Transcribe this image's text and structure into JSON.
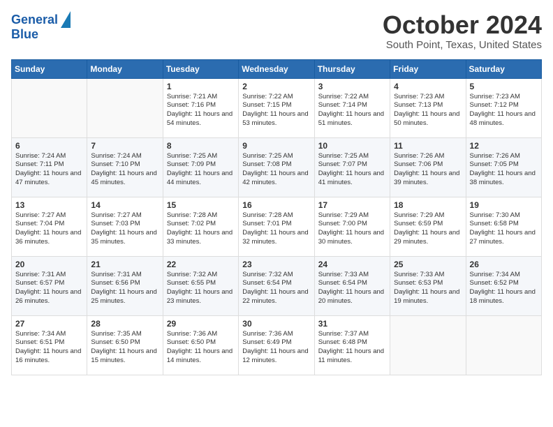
{
  "logo": {
    "line1": "General",
    "line2": "Blue"
  },
  "title": "October 2024",
  "location": "South Point, Texas, United States",
  "days_of_week": [
    "Sunday",
    "Monday",
    "Tuesday",
    "Wednesday",
    "Thursday",
    "Friday",
    "Saturday"
  ],
  "weeks": [
    [
      {
        "day": "",
        "info": ""
      },
      {
        "day": "",
        "info": ""
      },
      {
        "day": "1",
        "info": "Sunrise: 7:21 AM\nSunset: 7:16 PM\nDaylight: 11 hours and 54 minutes."
      },
      {
        "day": "2",
        "info": "Sunrise: 7:22 AM\nSunset: 7:15 PM\nDaylight: 11 hours and 53 minutes."
      },
      {
        "day": "3",
        "info": "Sunrise: 7:22 AM\nSunset: 7:14 PM\nDaylight: 11 hours and 51 minutes."
      },
      {
        "day": "4",
        "info": "Sunrise: 7:23 AM\nSunset: 7:13 PM\nDaylight: 11 hours and 50 minutes."
      },
      {
        "day": "5",
        "info": "Sunrise: 7:23 AM\nSunset: 7:12 PM\nDaylight: 11 hours and 48 minutes."
      }
    ],
    [
      {
        "day": "6",
        "info": "Sunrise: 7:24 AM\nSunset: 7:11 PM\nDaylight: 11 hours and 47 minutes."
      },
      {
        "day": "7",
        "info": "Sunrise: 7:24 AM\nSunset: 7:10 PM\nDaylight: 11 hours and 45 minutes."
      },
      {
        "day": "8",
        "info": "Sunrise: 7:25 AM\nSunset: 7:09 PM\nDaylight: 11 hours and 44 minutes."
      },
      {
        "day": "9",
        "info": "Sunrise: 7:25 AM\nSunset: 7:08 PM\nDaylight: 11 hours and 42 minutes."
      },
      {
        "day": "10",
        "info": "Sunrise: 7:25 AM\nSunset: 7:07 PM\nDaylight: 11 hours and 41 minutes."
      },
      {
        "day": "11",
        "info": "Sunrise: 7:26 AM\nSunset: 7:06 PM\nDaylight: 11 hours and 39 minutes."
      },
      {
        "day": "12",
        "info": "Sunrise: 7:26 AM\nSunset: 7:05 PM\nDaylight: 11 hours and 38 minutes."
      }
    ],
    [
      {
        "day": "13",
        "info": "Sunrise: 7:27 AM\nSunset: 7:04 PM\nDaylight: 11 hours and 36 minutes."
      },
      {
        "day": "14",
        "info": "Sunrise: 7:27 AM\nSunset: 7:03 PM\nDaylight: 11 hours and 35 minutes."
      },
      {
        "day": "15",
        "info": "Sunrise: 7:28 AM\nSunset: 7:02 PM\nDaylight: 11 hours and 33 minutes."
      },
      {
        "day": "16",
        "info": "Sunrise: 7:28 AM\nSunset: 7:01 PM\nDaylight: 11 hours and 32 minutes."
      },
      {
        "day": "17",
        "info": "Sunrise: 7:29 AM\nSunset: 7:00 PM\nDaylight: 11 hours and 30 minutes."
      },
      {
        "day": "18",
        "info": "Sunrise: 7:29 AM\nSunset: 6:59 PM\nDaylight: 11 hours and 29 minutes."
      },
      {
        "day": "19",
        "info": "Sunrise: 7:30 AM\nSunset: 6:58 PM\nDaylight: 11 hours and 27 minutes."
      }
    ],
    [
      {
        "day": "20",
        "info": "Sunrise: 7:31 AM\nSunset: 6:57 PM\nDaylight: 11 hours and 26 minutes."
      },
      {
        "day": "21",
        "info": "Sunrise: 7:31 AM\nSunset: 6:56 PM\nDaylight: 11 hours and 25 minutes."
      },
      {
        "day": "22",
        "info": "Sunrise: 7:32 AM\nSunset: 6:55 PM\nDaylight: 11 hours and 23 minutes."
      },
      {
        "day": "23",
        "info": "Sunrise: 7:32 AM\nSunset: 6:54 PM\nDaylight: 11 hours and 22 minutes."
      },
      {
        "day": "24",
        "info": "Sunrise: 7:33 AM\nSunset: 6:54 PM\nDaylight: 11 hours and 20 minutes."
      },
      {
        "day": "25",
        "info": "Sunrise: 7:33 AM\nSunset: 6:53 PM\nDaylight: 11 hours and 19 minutes."
      },
      {
        "day": "26",
        "info": "Sunrise: 7:34 AM\nSunset: 6:52 PM\nDaylight: 11 hours and 18 minutes."
      }
    ],
    [
      {
        "day": "27",
        "info": "Sunrise: 7:34 AM\nSunset: 6:51 PM\nDaylight: 11 hours and 16 minutes."
      },
      {
        "day": "28",
        "info": "Sunrise: 7:35 AM\nSunset: 6:50 PM\nDaylight: 11 hours and 15 minutes."
      },
      {
        "day": "29",
        "info": "Sunrise: 7:36 AM\nSunset: 6:50 PM\nDaylight: 11 hours and 14 minutes."
      },
      {
        "day": "30",
        "info": "Sunrise: 7:36 AM\nSunset: 6:49 PM\nDaylight: 11 hours and 12 minutes."
      },
      {
        "day": "31",
        "info": "Sunrise: 7:37 AM\nSunset: 6:48 PM\nDaylight: 11 hours and 11 minutes."
      },
      {
        "day": "",
        "info": ""
      },
      {
        "day": "",
        "info": ""
      }
    ]
  ]
}
